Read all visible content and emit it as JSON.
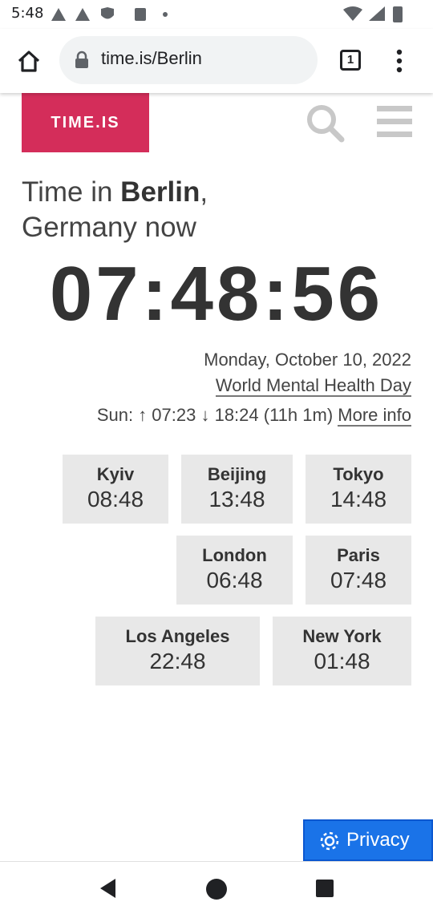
{
  "status_bar": {
    "time": "5:48"
  },
  "browser": {
    "url": "time.is/Berlin",
    "tab_count": "1"
  },
  "site": {
    "logo": "TIME.IS",
    "heading_prefix": "Time in ",
    "heading_city": "Berlin",
    "heading_suffix": ",",
    "heading_line2": "Germany now",
    "clock": "07:48:56",
    "date": "Monday, October 10, 2022",
    "holiday": "World Mental Health Day",
    "sun_text": "Sun: ↑ 07:23 ↓ 18:24 (11h 1m)",
    "more_info": "More info",
    "cities": [
      {
        "name": "Kyiv",
        "time": "08:48"
      },
      {
        "name": "Beijing",
        "time": "13:48"
      },
      {
        "name": "Tokyo",
        "time": "14:48"
      },
      {
        "name": "London",
        "time": "06:48"
      },
      {
        "name": "Paris",
        "time": "07:48"
      },
      {
        "name": "Los Angeles",
        "time": "22:48"
      },
      {
        "name": "New York",
        "time": "01:48"
      }
    ],
    "privacy_label": "Privacy"
  }
}
